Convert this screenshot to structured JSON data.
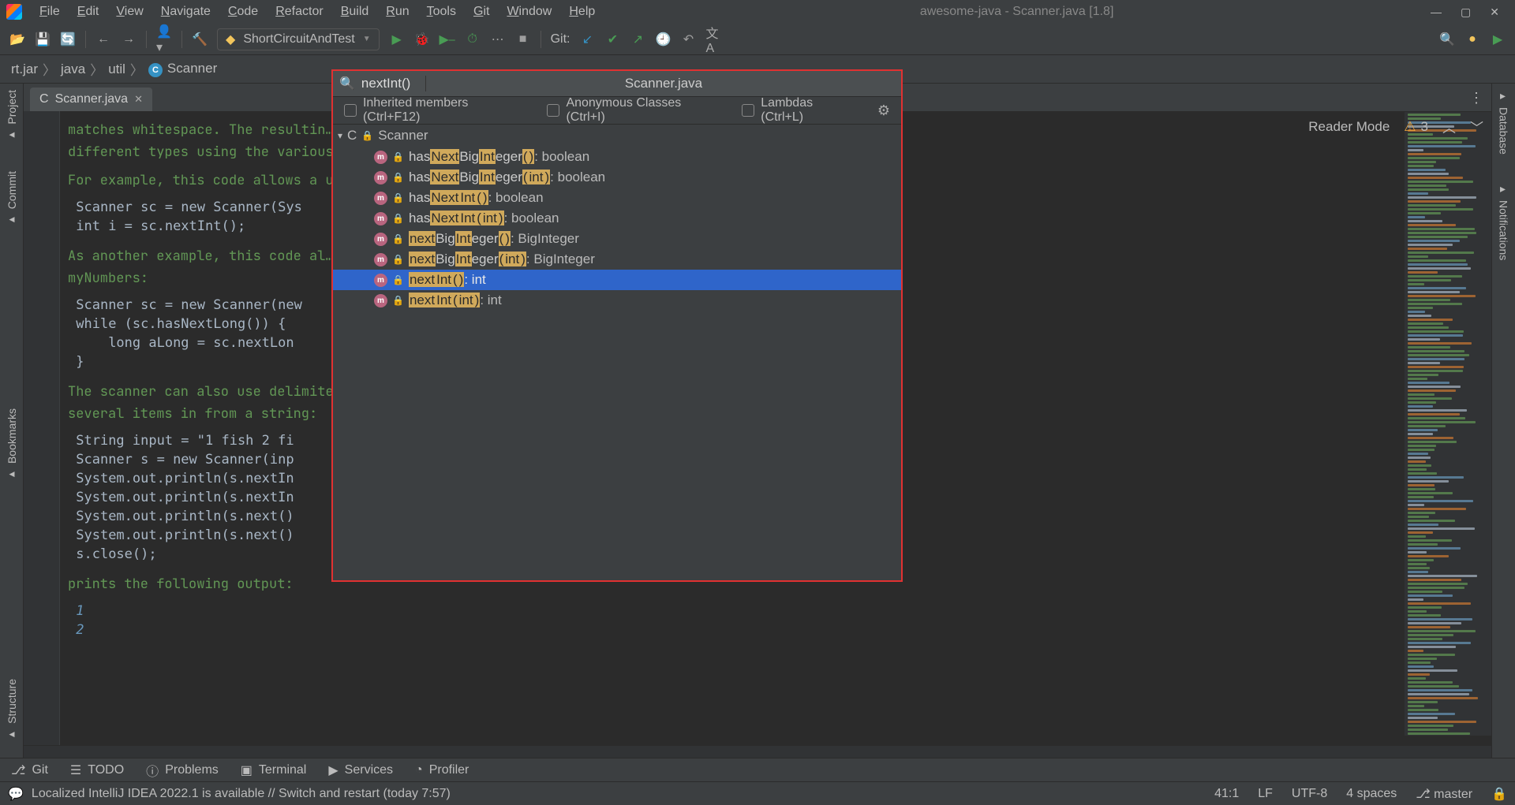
{
  "menubar": [
    "File",
    "Edit",
    "View",
    "Navigate",
    "Code",
    "Refactor",
    "Build",
    "Run",
    "Tools",
    "Git",
    "Window",
    "Help"
  ],
  "window_title": "awesome-java - Scanner.java [1.8]",
  "toolbar": {
    "run_config": "ShortCircuitAndTest",
    "git_label": "Git:"
  },
  "breadcrumbs": {
    "items": [
      "rt.jar",
      "java",
      "util"
    ],
    "leaf": "Scanner"
  },
  "editor": {
    "tab_name": "Scanner.java",
    "reader_mode_label": "Reader Mode",
    "warn_count": "3",
    "doc1_line1": "matches whitespace. The resultin…",
    "doc1_line2": "different types using the various",
    "doc2": "For example, this code allows a u…",
    "code1_l1": "Scanner sc = new Scanner(Sys",
    "code1_l2": "int i = sc.nextInt();",
    "doc3_l1": "As another example, this code al…",
    "doc3_l2": "myNumbers:",
    "code2_l1": "Scanner sc = new Scanner(new",
    "code2_l2": "while (sc.hasNextLong()) {",
    "code2_l3": "    long aLong = sc.nextLon",
    "code2_l4": "}",
    "doc4_l1": "The scanner can also use delimite…",
    "doc4_l2": "several items in from a string:",
    "code3_l1": "String input = \"1 fish 2 fi",
    "code3_l2": "Scanner s = new Scanner(inp",
    "code3_l3": "System.out.println(s.nextIn",
    "code3_l4": "System.out.println(s.nextIn",
    "code3_l5": "System.out.println(s.next()",
    "code3_l6": "System.out.println(s.next()",
    "code3_l7": "s.close();",
    "doc5": "prints the following output:",
    "out1": "1",
    "out2": "2"
  },
  "popup": {
    "search_value": "nextInt()",
    "title": "Scanner.java",
    "filter_inherited": "Inherited members (Ctrl+F12)",
    "filter_anon": "Anonymous Classes (Ctrl+I)",
    "filter_lambda": "Lambdas (Ctrl+L)",
    "tree_root": "Scanner",
    "items": [
      {
        "parts": [
          "has",
          "Next",
          "Big",
          "Int",
          "eger",
          "(",
          ")"
        ],
        "ret": ": boolean"
      },
      {
        "parts": [
          "has",
          "Next",
          "Big",
          "Int",
          "eger",
          "(",
          "int",
          ")"
        ],
        "ret": ": boolean"
      },
      {
        "parts": [
          "has",
          "Next",
          "Int",
          "(",
          ")"
        ],
        "ret": ": boolean"
      },
      {
        "parts": [
          "has",
          "Next",
          "Int",
          "(",
          "int",
          ")"
        ],
        "ret": ": boolean"
      },
      {
        "parts": [
          "next",
          "Big",
          "Int",
          "eger",
          "(",
          ")"
        ],
        "ret": ": BigInteger"
      },
      {
        "parts": [
          "next",
          "Big",
          "Int",
          "eger",
          "(",
          "int",
          ")"
        ],
        "ret": ": BigInteger"
      },
      {
        "parts": [
          "next",
          "Int",
          "(",
          ")"
        ],
        "ret": ": int",
        "selected": true
      },
      {
        "parts": [
          "next",
          "Int",
          "(",
          "int",
          ")"
        ],
        "ret": ": int"
      }
    ],
    "highlight_tokens": [
      "Next",
      "next",
      "Int",
      "int",
      "(",
      ")"
    ]
  },
  "bottom_tools": {
    "git": "Git",
    "todo": "TODO",
    "problems": "Problems",
    "terminal": "Terminal",
    "services": "Services",
    "profiler": "Profiler"
  },
  "statusbar": {
    "message": "Localized IntelliJ IDEA 2022.1 is available // Switch and restart (today 7:57)",
    "pos": "41:1",
    "line_sep": "LF",
    "encoding": "UTF-8",
    "indent": "4 spaces",
    "branch": "master"
  },
  "sidepanels": {
    "left": [
      "Project",
      "Commit",
      "Bookmarks",
      "Structure"
    ],
    "right": [
      "Database",
      "Notifications"
    ]
  }
}
